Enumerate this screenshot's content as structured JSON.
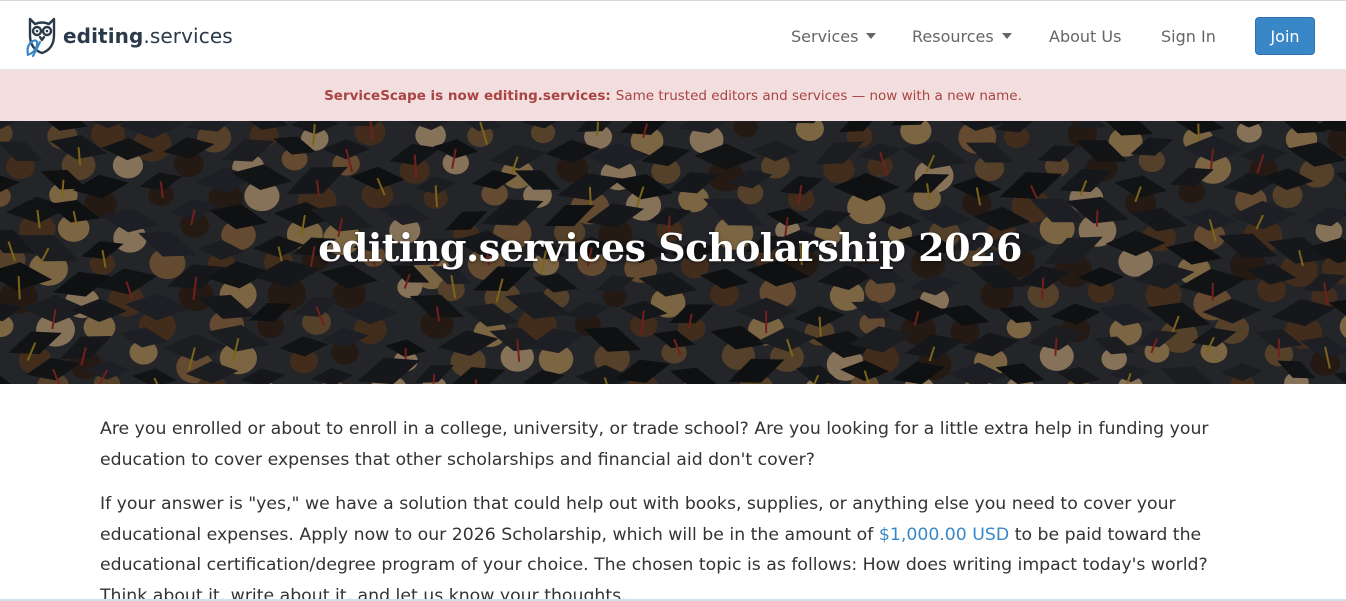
{
  "brand": {
    "logo_bold": "editing",
    "logo_rest": ".services",
    "logo_icon": "owl-icon"
  },
  "nav": {
    "services_label": "Services",
    "resources_label": "Resources",
    "about_label": "About Us",
    "signin_label": "Sign In",
    "join_label": "Join"
  },
  "notice": {
    "strong": "ServiceScape is now editing.services:",
    "text": "Same trusted editors and services — now with a new name."
  },
  "hero": {
    "title": "editing.services Scholarship 2026"
  },
  "content": {
    "p1": "Are you enrolled or about to enroll in a college, university, or trade school? Are you looking for a little extra help in funding your education to cover expenses that other scholarships and financial aid don't cover?",
    "p2_before": "If your answer is \"yes,\" we have a solution that could help out with books, supplies, or anything else you need to cover your educational expenses. Apply now to our 2026 Scholarship, which will be in the amount of ",
    "p2_link": "$1,000.00 USD",
    "p2_after": " to be paid toward the educational certification/degree program of your choice. The chosen topic is as follows: How does writing impact today's world? Think about it, write about it, and let us know your thoughts."
  },
  "colors": {
    "primary": "#3a87c8",
    "notice_bg": "#f2dede",
    "notice_text": "#a94442",
    "logo_text": "#2b3a4a"
  }
}
